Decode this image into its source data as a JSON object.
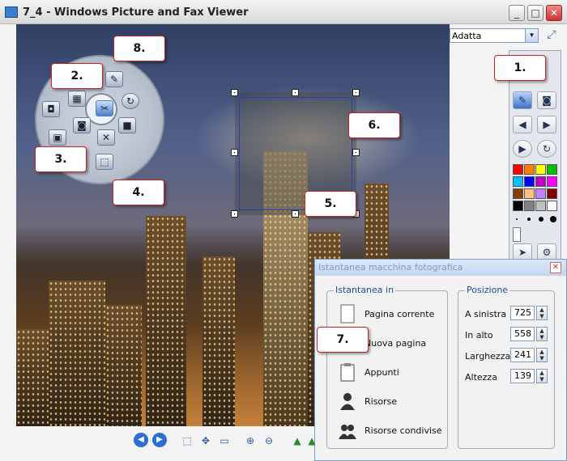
{
  "window": {
    "title": "7_4 - Windows Picture and Fax Viewer",
    "minimize": "_",
    "maximize": "□",
    "close": "✕"
  },
  "zoom_combo": {
    "value": "Adatta",
    "arrow": "▾"
  },
  "fullscreen_glyph": "⤢",
  "callouts": [
    "1.",
    "2.",
    "3.",
    "4.",
    "5.",
    "6.",
    "7.",
    "8."
  ],
  "palette_colors": [
    "#ff0000",
    "#ff8000",
    "#ffff00",
    "#00c000",
    "#00c0ff",
    "#0000ff",
    "#c000c0",
    "#ff00ff",
    "#804000",
    "#ffc080",
    "#c080ff",
    "#800000",
    "#000000",
    "#808080",
    "#c0c0c0",
    "#ffffff"
  ],
  "dialog": {
    "title": "Istantanea macchina fotografica",
    "close": "✕",
    "group_left": "Istantanea in",
    "options": [
      {
        "label": "Pagina corrente",
        "icon": "page-icon"
      },
      {
        "label": "Nuova pagina",
        "icon": "new-page-icon"
      },
      {
        "label": "Appunti",
        "icon": "clipboard-icon"
      },
      {
        "label": "Risorse",
        "icon": "person-icon"
      },
      {
        "label": "Risorse condivise",
        "icon": "people-icon"
      }
    ],
    "group_right": "Posizione",
    "fields": [
      {
        "label": "A sinistra",
        "value": "725"
      },
      {
        "label": "In alto",
        "value": "558"
      },
      {
        "label": "Larghezza",
        "value": "241"
      },
      {
        "label": "Altezza",
        "value": "139"
      }
    ]
  }
}
